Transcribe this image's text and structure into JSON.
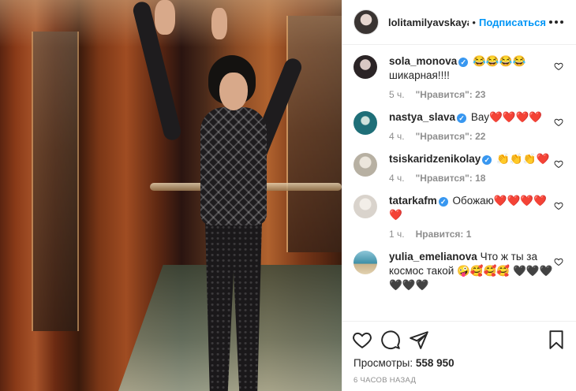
{
  "post": {
    "username": "lolitamilyavskaya",
    "separator": "•",
    "follow_label": "Подписаться"
  },
  "comments": [
    {
      "username": "sola_monova",
      "verified": true,
      "text": "😂😂😂😂 шикарная!!!!",
      "time": "5 ч.",
      "likes": "\"Нравится\": 23",
      "avatar_color": "#2b2426"
    },
    {
      "username": "nastya_slava",
      "verified": true,
      "text": "Вау❤️❤️❤️❤️",
      "time": "4 ч.",
      "likes": "\"Нравится\": 22",
      "avatar_color": "#1f6f78"
    },
    {
      "username": "tsiskaridzenikolay",
      "verified": true,
      "text": "👏👏👏❤️",
      "time": "4 ч.",
      "likes": "\"Нравится\": 18",
      "avatar_color": "#b7b0a2"
    },
    {
      "username": "tatarkafm",
      "verified": true,
      "text": "Обожаю❤️❤️❤️❤️❤️",
      "time": "1 ч.",
      "likes": "Нравится: 1",
      "avatar_color": "#d9d3cc"
    },
    {
      "username": "yulia_emelianova",
      "verified": false,
      "text": "Что ж ты за космос такой 🤪🥰🥰🥰 🖤🖤🖤🖤🖤🖤",
      "time": "",
      "likes": "",
      "avatar_color": "#3d8fa6"
    }
  ],
  "stats": {
    "views_label": "Просмотры:",
    "views_count": "558 950",
    "time_ago": "6 ЧАСОВ НАЗАД"
  },
  "icons": {
    "like": "heart-icon",
    "comment": "comment-icon",
    "share": "share-icon",
    "save": "bookmark-icon",
    "more": "more-icon"
  },
  "colors": {
    "accent": "#0095f6",
    "verified": "#3897f0",
    "muted": "#8e8e8e",
    "text": "#262626"
  }
}
